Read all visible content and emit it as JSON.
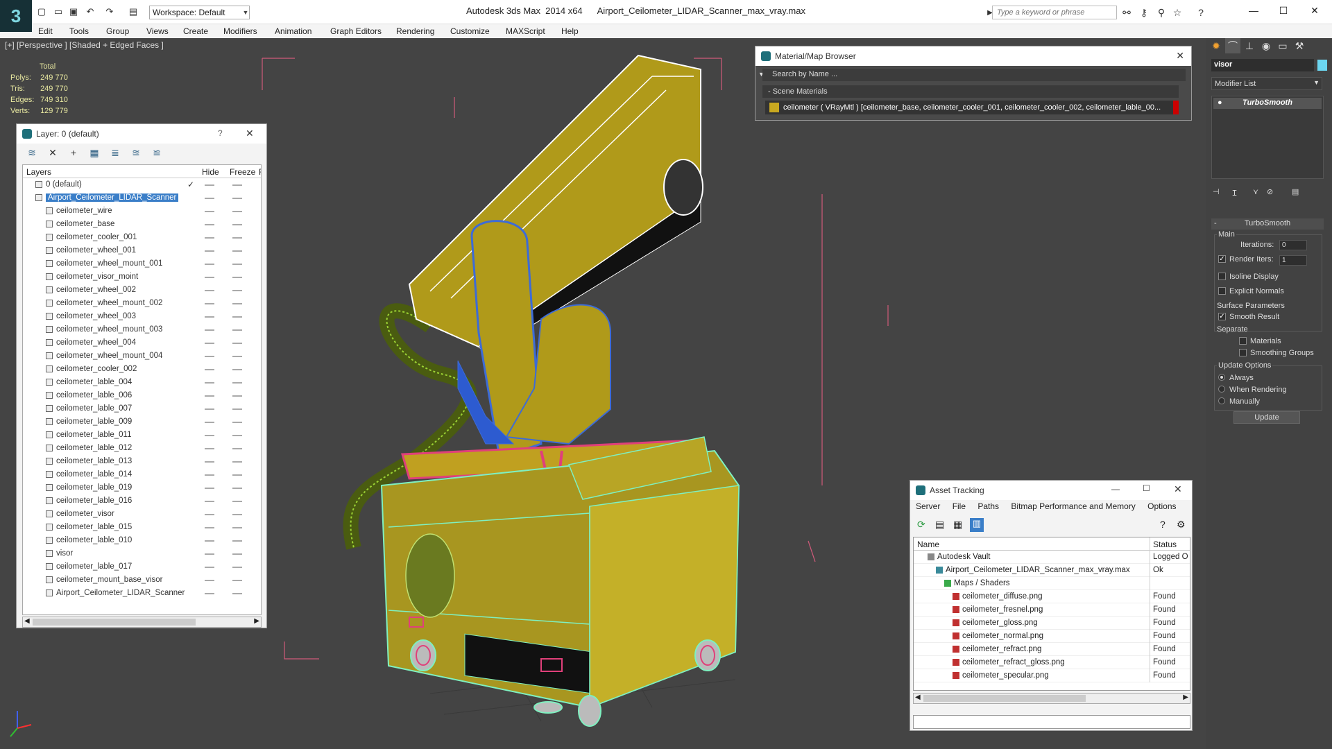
{
  "app": {
    "logo_letter": "3",
    "title": "Autodesk 3ds Max  2014 x64      Airport_Ceilometer_LIDAR_Scanner_max_vray.max",
    "workspace": "Workspace: Default",
    "search_placeholder": "Type a keyword or phrase"
  },
  "menu": [
    "Edit",
    "Tools",
    "Group",
    "Views",
    "Create",
    "Modifiers",
    "Animation",
    "Graph Editors",
    "Rendering",
    "Customize",
    "MAXScript",
    "Help"
  ],
  "viewport": {
    "label": "[+] [Perspective ] [Shaded + Edged Faces ]",
    "stats_header": "Total",
    "stats": [
      {
        "k": "Polys:",
        "v": "249 770"
      },
      {
        "k": "Tris:",
        "v": "249 770"
      },
      {
        "k": "Edges:",
        "v": "749 310"
      },
      {
        "k": "Verts:",
        "v": "129 779"
      }
    ]
  },
  "layer_panel": {
    "title": "Layer: 0 (default)",
    "help": "?",
    "col_layers": "Layers",
    "col_hide": "Hide",
    "col_freeze": "Freeze",
    "col_r": "R",
    "rows": [
      {
        "name": "0 (default)",
        "level": 0,
        "check": "✓"
      },
      {
        "name": "Airport_Ceilometer_LIDAR_Scanner",
        "level": 0,
        "selected": true
      },
      {
        "name": "ceilometer_wire",
        "level": 1
      },
      {
        "name": "ceilometer_base",
        "level": 1
      },
      {
        "name": "ceilometer_cooler_001",
        "level": 1
      },
      {
        "name": "ceilometer_wheel_001",
        "level": 1
      },
      {
        "name": "ceilometer_wheel_mount_001",
        "level": 1
      },
      {
        "name": "ceilometer_visor_moint",
        "level": 1
      },
      {
        "name": "ceilometer_wheel_002",
        "level": 1
      },
      {
        "name": "ceilometer_wheel_mount_002",
        "level": 1
      },
      {
        "name": "ceilometer_wheel_003",
        "level": 1
      },
      {
        "name": "ceilometer_wheel_mount_003",
        "level": 1
      },
      {
        "name": "ceilometer_wheel_004",
        "level": 1
      },
      {
        "name": "ceilometer_wheel_mount_004",
        "level": 1
      },
      {
        "name": "ceilometer_cooler_002",
        "level": 1
      },
      {
        "name": "ceilometer_lable_004",
        "level": 1
      },
      {
        "name": "ceilometer_lable_006",
        "level": 1
      },
      {
        "name": "ceilometer_lable_007",
        "level": 1
      },
      {
        "name": "ceilometer_lable_009",
        "level": 1
      },
      {
        "name": "ceilometer_lable_011",
        "level": 1
      },
      {
        "name": "ceilometer_lable_012",
        "level": 1
      },
      {
        "name": "ceilometer_lable_013",
        "level": 1
      },
      {
        "name": "ceilometer_lable_014",
        "level": 1
      },
      {
        "name": "ceilometer_lable_019",
        "level": 1
      },
      {
        "name": "ceilometer_lable_016",
        "level": 1
      },
      {
        "name": "ceilometer_visor",
        "level": 1
      },
      {
        "name": "ceilometer_lable_015",
        "level": 1
      },
      {
        "name": "ceilometer_lable_010",
        "level": 1
      },
      {
        "name": "visor",
        "level": 1
      },
      {
        "name": "ceilometer_lable_017",
        "level": 1
      },
      {
        "name": "ceilometer_mount_base_visor",
        "level": 1
      },
      {
        "name": "Airport_Ceilometer_LIDAR_Scanner",
        "level": 1
      }
    ]
  },
  "material_browser": {
    "title": "Material/Map Browser",
    "search": "Search by Name ...",
    "category": "- Scene Materials",
    "item": "ceilometer  ( VRayMtl )  [ceilometer_base, ceilometer_cooler_001, ceilometer_cooler_002, ceilometer_lable_00..."
  },
  "asset_tracking": {
    "title": "Asset Tracking",
    "menu": [
      "Server",
      "File",
      "Paths",
      "Bitmap Performance and Memory",
      "Options"
    ],
    "col_name": "Name",
    "col_status": "Status",
    "rows": [
      {
        "name": "Autodesk Vault",
        "status": "Logged O",
        "level": 0
      },
      {
        "name": "Airport_Ceilometer_LIDAR_Scanner_max_vray.max",
        "status": "Ok",
        "level": 1
      },
      {
        "name": "Maps / Shaders",
        "status": "",
        "level": 2
      },
      {
        "name": "ceilometer_diffuse.png",
        "status": "Found",
        "level": 3
      },
      {
        "name": "ceilometer_fresnel.png",
        "status": "Found",
        "level": 3
      },
      {
        "name": "ceilometer_gloss.png",
        "status": "Found",
        "level": 3
      },
      {
        "name": "ceilometer_normal.png",
        "status": "Found",
        "level": 3
      },
      {
        "name": "ceilometer_refract.png",
        "status": "Found",
        "level": 3
      },
      {
        "name": "ceilometer_refract_gloss.png",
        "status": "Found",
        "level": 3
      },
      {
        "name": "ceilometer_specular.png",
        "status": "Found",
        "level": 3
      }
    ]
  },
  "command_panel": {
    "object_name": "visor",
    "modifier_list": "Modifier List",
    "stack_item": "TurboSmooth",
    "rollout": "TurboSmooth",
    "main": "Main",
    "iterations_label": "Iterations:",
    "iterations": "0",
    "render_iters_label": "Render Iters:",
    "render_iters": "1",
    "isoline": "Isoline Display",
    "explicit": "Explicit Normals",
    "surface": "Surface Parameters",
    "smooth_result": "Smooth Result",
    "separate": "Separate",
    "materials": "Materials",
    "smoothing_groups": "Smoothing Groups",
    "update_options": "Update Options",
    "always": "Always",
    "when_rendering": "When Rendering",
    "manually": "Manually",
    "update": "Update"
  }
}
